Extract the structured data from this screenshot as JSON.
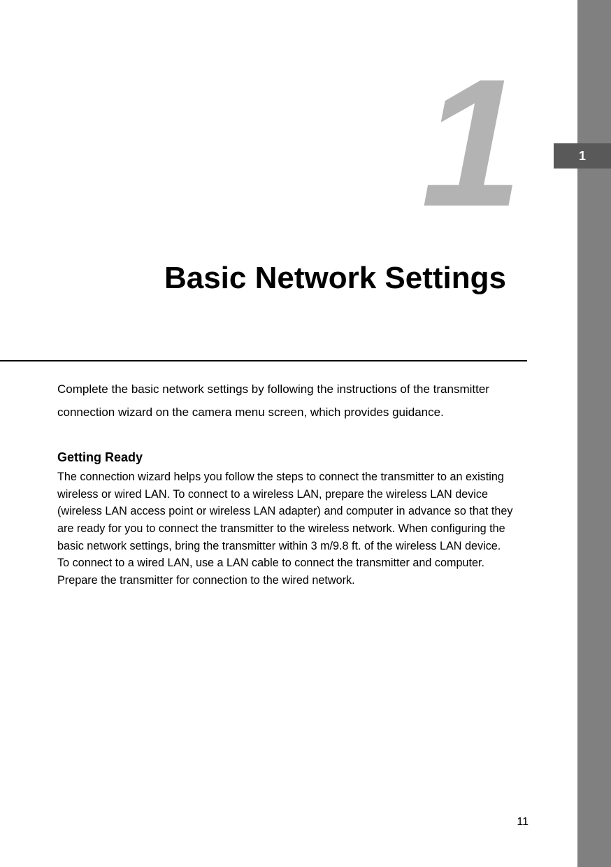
{
  "sidebar": {
    "tab_label": "1"
  },
  "chapter": {
    "number": "1",
    "title": "Basic Network Settings"
  },
  "intro": "Complete the basic network settings by following the instructions of the transmitter connection wizard on the camera menu screen, which provides guidance.",
  "section": {
    "heading": "Getting Ready",
    "body": "The connection wizard helps you follow the steps to connect the transmitter to an existing wireless or wired LAN.\nTo connect to a wireless LAN, prepare the wireless LAN device (wireless LAN access point or wireless LAN adapter) and computer in advance so that they are ready for you to connect the transmitter to the wireless network. When configuring the basic network settings, bring the transmitter within 3 m/9.8 ft. of the wireless LAN device.\nTo connect to a wired LAN, use a LAN cable to connect the transmitter and computer. Prepare the transmitter for connection to the wired network."
  },
  "page_number": "11"
}
